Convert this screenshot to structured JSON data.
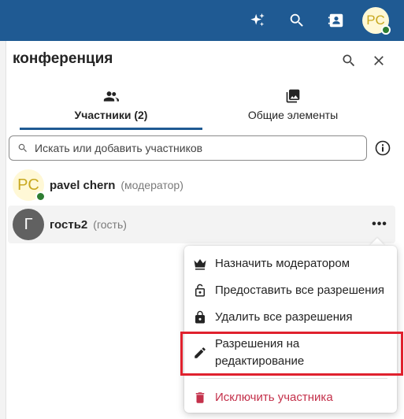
{
  "topbar": {
    "avatar_initials": "PC",
    "icons": [
      "sparkle-icon",
      "search-icon",
      "contacts-icon"
    ],
    "colors": {
      "background": "#1f5a93",
      "presence": "#2e7d32"
    }
  },
  "panel": {
    "title": "конференция"
  },
  "tabs": [
    {
      "label": "Участники (2)",
      "icon": "people-icon",
      "active": true
    },
    {
      "label": "Общие элементы",
      "icon": "photos-icon",
      "active": false
    }
  ],
  "search": {
    "placeholder": "Искать или добавить участников",
    "value": ""
  },
  "participants": [
    {
      "initials": "PC",
      "name": "pavel chern",
      "role": "(модератор)",
      "online": true
    },
    {
      "initials": "Г",
      "name": "гость2",
      "role": "(гость)",
      "online": false
    }
  ],
  "context_menu": {
    "items": [
      {
        "label": "Назначить модератором",
        "icon": "crown-icon"
      },
      {
        "label": "Предоставить все разрешения",
        "icon": "unlock-icon"
      },
      {
        "label": "Удалить все разрешения",
        "icon": "lock-icon"
      },
      {
        "label_line1": "Разрешения на",
        "label_line2": "редактирование",
        "icon": "pencil-icon",
        "highlighted": true
      },
      {
        "label": "Исключить участника",
        "icon": "trash-icon",
        "danger": true
      }
    ],
    "colors": {
      "danger": "#c4314b",
      "highlight_border": "#e0212e"
    }
  }
}
